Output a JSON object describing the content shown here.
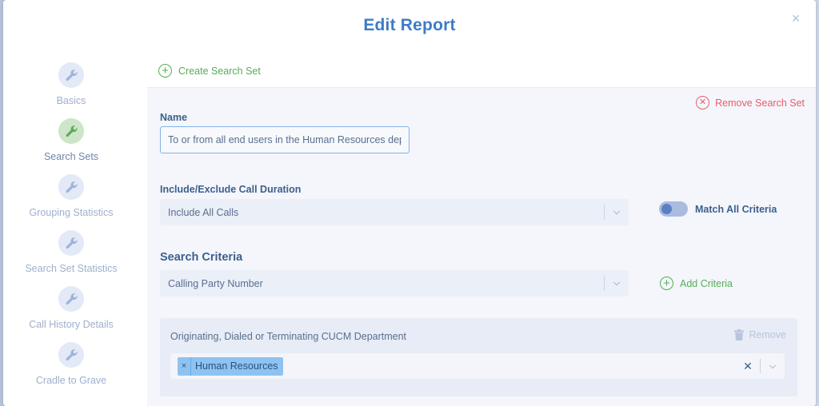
{
  "modal": {
    "title": "Edit Report",
    "close_glyph": "×"
  },
  "sidebar": {
    "items": [
      {
        "label": "Basics",
        "icon": "wrench-icon",
        "active": false
      },
      {
        "label": "Search Sets",
        "icon": "wrench-icon",
        "active": true
      },
      {
        "label": "Grouping Statistics",
        "icon": "wrench-icon",
        "active": false
      },
      {
        "label": "Search Set Statistics",
        "icon": "wrench-icon",
        "active": false
      },
      {
        "label": "Call History Details",
        "icon": "wrench-icon",
        "active": false
      },
      {
        "label": "Cradle to Grave",
        "icon": "wrench-icon",
        "active": false
      }
    ]
  },
  "main": {
    "create_search_set": "Create Search Set",
    "remove_search_set": "Remove Search Set",
    "name_label": "Name",
    "name_value": "To or from all end users in the Human Resources depart",
    "duration_label": "Include/Exclude Call Duration",
    "duration_value": "Include All Calls",
    "match_all_label": "Match All Criteria",
    "search_criteria_title": "Search Criteria",
    "criteria_select_value": "Calling Party Number",
    "add_criteria": "Add Criteria",
    "criteria_card": {
      "title": "Originating, Dialed or Terminating CUCM Department",
      "remove_label": "Remove",
      "chips": [
        "Human Resources"
      ]
    }
  },
  "colors": {
    "accent_blue": "#3e7bc7",
    "green": "#56ad55",
    "red": "#ee5a6b",
    "chip_blue": "#8ec3f1"
  }
}
